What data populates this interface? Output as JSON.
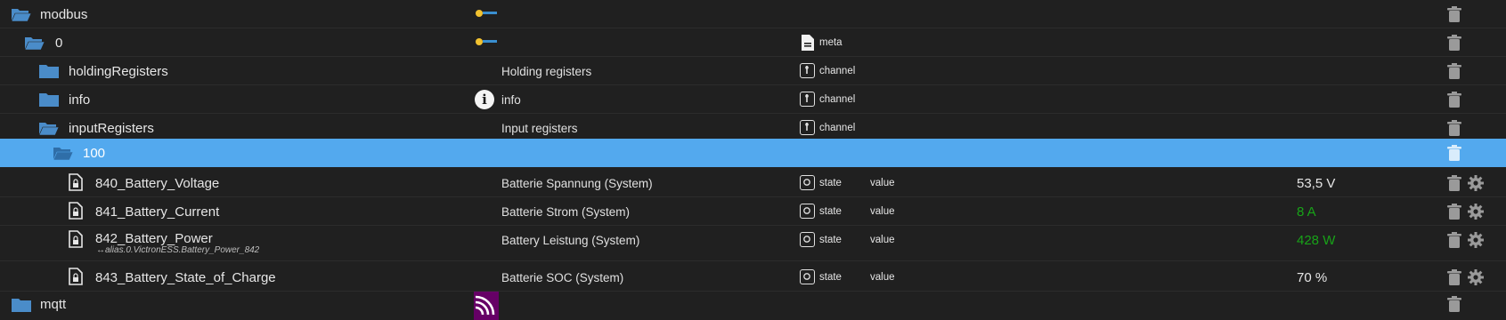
{
  "tree": {
    "modbus": {
      "name": "modbus"
    },
    "instance": {
      "name": "0",
      "type_label": "meta"
    },
    "holding": {
      "name": "holdingRegisters",
      "desc": "Holding registers",
      "type_label": "channel"
    },
    "info": {
      "name": "info",
      "desc": "info",
      "type_label": "channel"
    },
    "input": {
      "name": "inputRegisters",
      "desc": "Input registers",
      "type_label": "channel"
    },
    "selected": {
      "name": "100"
    },
    "states": [
      {
        "name": "840_Battery_Voltage",
        "desc": "Batterie Spannung (System)",
        "type_label": "state",
        "role": "value",
        "value": "53,5 V",
        "value_color": "#e6e6e6"
      },
      {
        "name": "841_Battery_Current",
        "desc": "Batterie Strom (System)",
        "type_label": "state",
        "role": "value",
        "value": "8 A",
        "value_color": "#18a318"
      },
      {
        "name": "842_Battery_Power",
        "alias": "↔alias.0.VictronESS.Battery_Power_842",
        "desc": "Battery Leistung (System)",
        "type_label": "state",
        "role": "value",
        "value": "428 W",
        "value_color": "#18a318"
      },
      {
        "name": "843_Battery_State_of_Charge",
        "desc": "Batterie SOC (System)",
        "type_label": "state",
        "role": "value",
        "value": "70 %",
        "value_color": "#e6e6e6"
      }
    ],
    "mqtt": {
      "name": "mqtt"
    }
  },
  "colors": {
    "background": "#202020",
    "selected_row": "#53a9ee",
    "folder": "#4a8cc9",
    "value_green": "#18a318"
  }
}
